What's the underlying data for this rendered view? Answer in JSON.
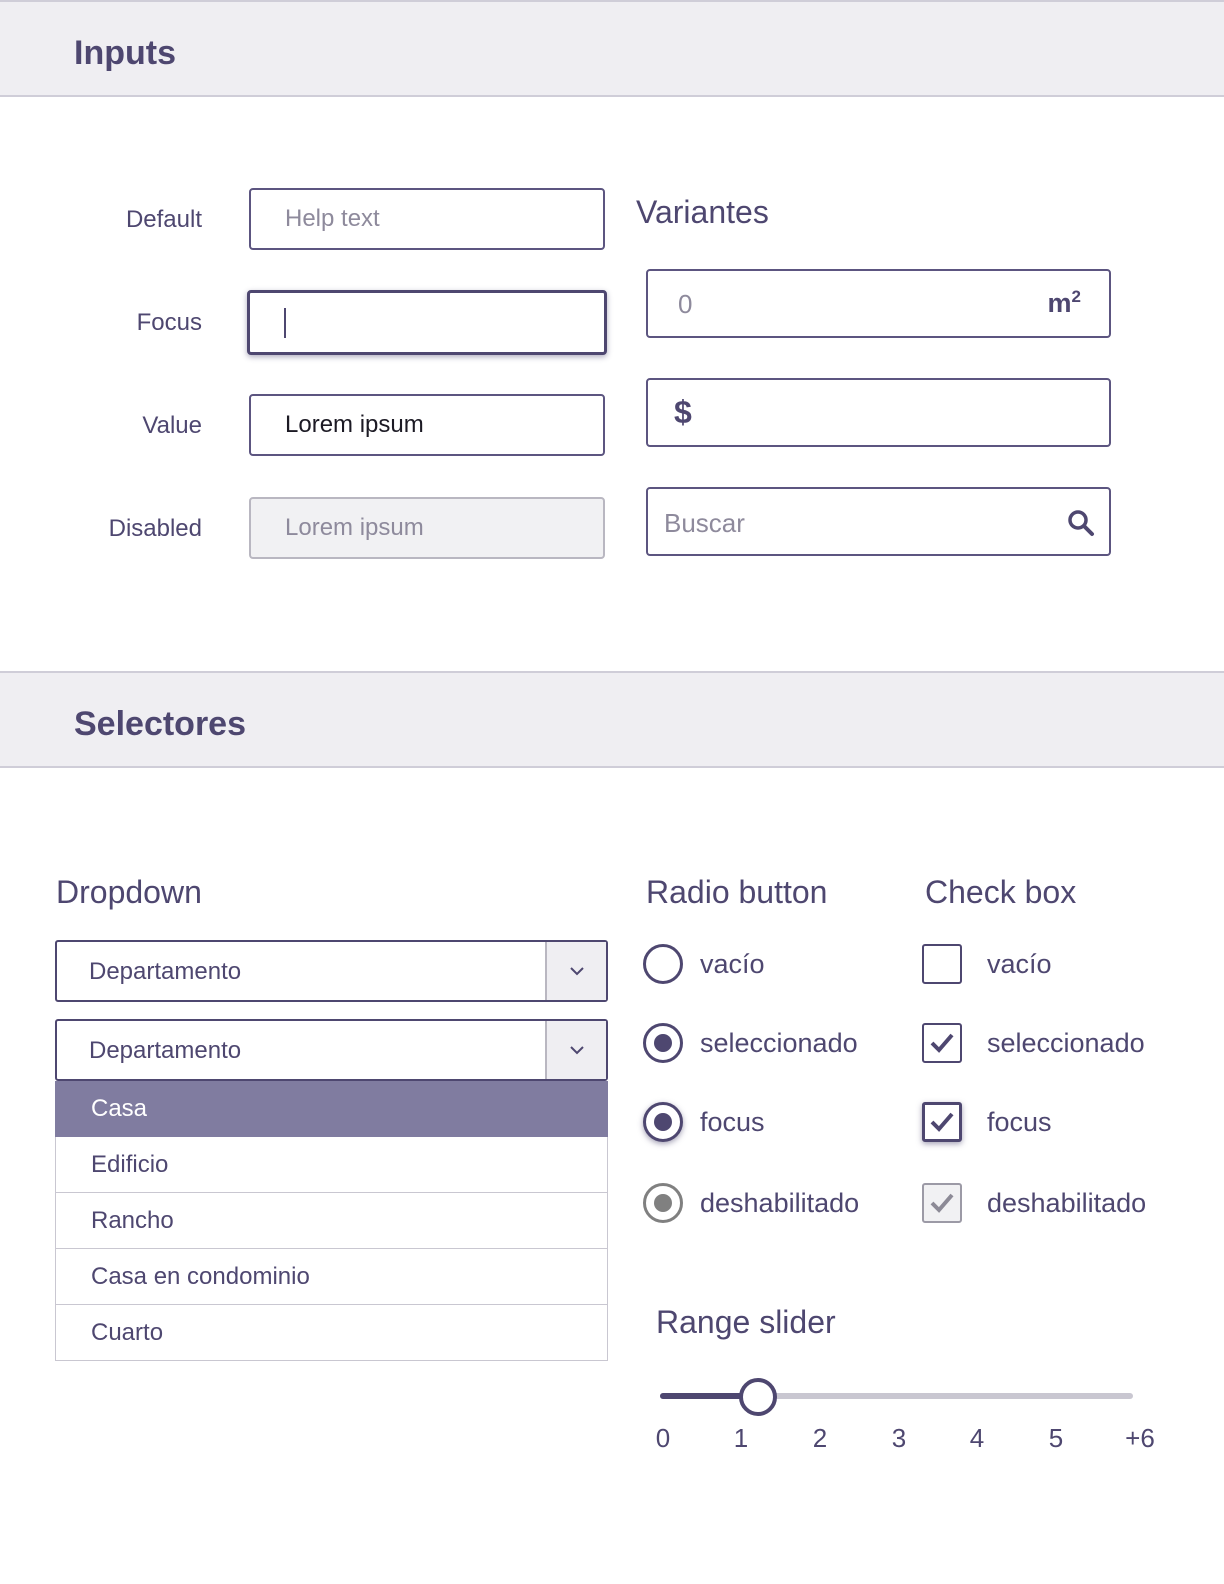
{
  "inputs_section": {
    "title": "Inputs",
    "rows": {
      "default_label": "Default",
      "default_placeholder": "Help text",
      "focus_label": "Focus",
      "value_label": "Value",
      "value_text": "Lorem ipsum",
      "disabled_label": "Disabled",
      "disabled_text": "Lorem ipsum"
    },
    "variants": {
      "title": "Variantes",
      "area_value": "0",
      "area_unit": "m",
      "area_unit_exp": "2",
      "currency_symbol": "$",
      "search_placeholder": "Buscar",
      "search_icon": "search-icon"
    }
  },
  "selectors_section": {
    "title": "Selectores",
    "dropdown": {
      "title": "Dropdown",
      "closed_value": "Departamento",
      "open_value": "Departamento",
      "options": [
        "Casa",
        "Edificio",
        "Rancho",
        "Casa en condominio",
        "Cuarto"
      ],
      "selected_option": "Casa"
    },
    "radio": {
      "title": "Radio button",
      "items": [
        "vacío",
        "seleccionado",
        "focus",
        "deshabilitado"
      ]
    },
    "checkbox": {
      "title": "Check box",
      "items": [
        "vacío",
        "seleccionado",
        "focus",
        "deshabilitado"
      ]
    },
    "range_slider": {
      "title": "Range slider",
      "ticks": [
        "0",
        "1",
        "2",
        "3",
        "4",
        "5",
        "+6"
      ],
      "value": 1,
      "min": 0,
      "max": 6
    }
  },
  "colors": {
    "accent": "#4e4770",
    "selected_option_bg": "#807ca0",
    "header_bg": "#efeef2"
  }
}
